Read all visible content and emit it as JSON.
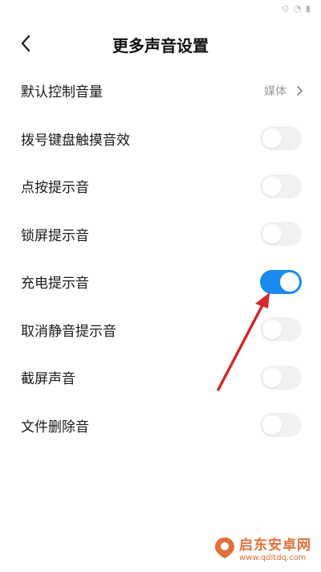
{
  "status_bar": {
    "text": "⊙ ◔ ▮"
  },
  "header": {
    "title": "更多声音设置"
  },
  "settings": [
    {
      "label": "默认控制音量",
      "type": "link",
      "value": "媒体"
    },
    {
      "label": "拨号键盘触摸音效",
      "type": "toggle",
      "on": false
    },
    {
      "label": "点按提示音",
      "type": "toggle",
      "on": false
    },
    {
      "label": "锁屏提示音",
      "type": "toggle",
      "on": false
    },
    {
      "label": "充电提示音",
      "type": "toggle",
      "on": true
    },
    {
      "label": "取消静音提示音",
      "type": "toggle",
      "on": false
    },
    {
      "label": "截屏声音",
      "type": "toggle",
      "on": false
    },
    {
      "label": "文件删除音",
      "type": "toggle",
      "on": false
    }
  ],
  "watermark": {
    "title": "启东安卓网",
    "url": "www.qdltdq.com"
  },
  "colors": {
    "toggle_on": "#1a8cf0",
    "toggle_off": "#f1f1f1",
    "arrow": "#d9262c",
    "watermark": "#e2703a"
  },
  "icons": {
    "back": "chevron-left-icon",
    "chevron": "chevron-right-icon"
  }
}
